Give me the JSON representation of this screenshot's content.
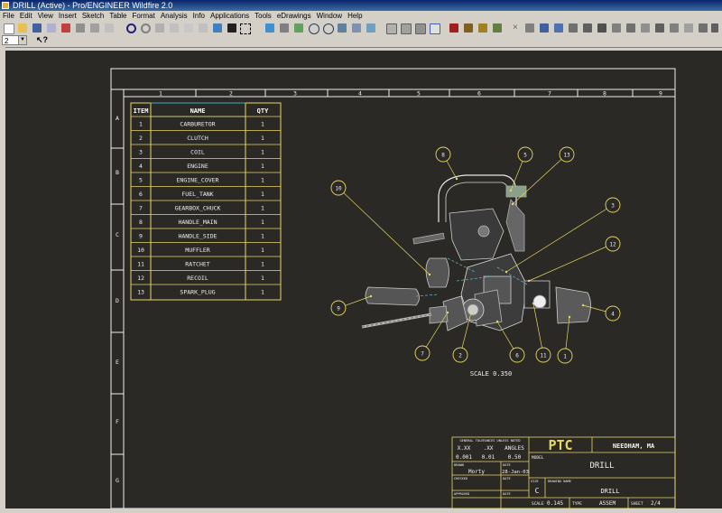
{
  "window": {
    "title": "DRILL (Active) - Pro/ENGINEER Wildfire 2.0"
  },
  "menu": [
    "File",
    "Edit",
    "View",
    "Insert",
    "Sketch",
    "Table",
    "Format",
    "Analysis",
    "Info",
    "Applications",
    "Tools",
    "eDrawings",
    "Window",
    "Help"
  ],
  "sheet_selector": {
    "value": "2"
  },
  "zone_columns": [
    "1",
    "2",
    "3",
    "4",
    "5",
    "6",
    "7",
    "8",
    "9"
  ],
  "zone_rows": [
    "A",
    "B",
    "C",
    "D",
    "E",
    "F",
    "G"
  ],
  "bom": {
    "headers": [
      "ITEM",
      "NAME",
      "QTY"
    ],
    "rows": [
      {
        "item": "1",
        "name": "CARBURETOR",
        "qty": "1"
      },
      {
        "item": "2",
        "name": "CLUTCH",
        "qty": "1"
      },
      {
        "item": "3",
        "name": "COIL",
        "qty": "1"
      },
      {
        "item": "4",
        "name": "ENGINE",
        "qty": "1"
      },
      {
        "item": "5",
        "name": "ENGINE_COVER",
        "qty": "1"
      },
      {
        "item": "6",
        "name": "FUEL_TANK",
        "qty": "1"
      },
      {
        "item": "7",
        "name": "GEARBOX_CHUCK",
        "qty": "1"
      },
      {
        "item": "8",
        "name": "HANDLE_MAIN",
        "qty": "1"
      },
      {
        "item": "9",
        "name": "HANDLE_SIDE",
        "qty": "1"
      },
      {
        "item": "10",
        "name": "MUFFLER",
        "qty": "1"
      },
      {
        "item": "11",
        "name": "RATCHET",
        "qty": "1"
      },
      {
        "item": "12",
        "name": "RECOIL",
        "qty": "1"
      },
      {
        "item": "13",
        "name": "SPARK_PLUG",
        "qty": "1"
      }
    ]
  },
  "balloons": [
    "1",
    "2",
    "3",
    "4",
    "5",
    "6",
    "7",
    "8",
    "9",
    "10",
    "11",
    "12",
    "13"
  ],
  "scale_note": "SCALE  0.350",
  "title_block": {
    "tolerance_header": "GENERAL TOLERANCES UNLESS NOTED",
    "tol_labels": [
      "X.XX",
      ".XX",
      "ANGLES"
    ],
    "tol_values": [
      "0.001",
      "0.01",
      "0.50"
    ],
    "drawn_label": "DRAWN",
    "drawn_value": "Morty",
    "date_label": "DATE",
    "date_value": "28-Jan-03",
    "checked_label": "CHECKED",
    "approved_label": "APPROVED",
    "company": "PTC",
    "location": "NEEDHAM, MA",
    "model_label": "MODEL",
    "model_value": "DRILL",
    "size_label": "SIZE",
    "size_value": "C",
    "drawing_name_label": "DRAWING NAME",
    "drawing_name_value": "DRILL",
    "scale_label": "SCALE",
    "scale_value": "0.145",
    "type_label": "TYPE",
    "type_value": "ASSEM",
    "sheet_label": "SHEET",
    "sheet_value": "2/4"
  }
}
